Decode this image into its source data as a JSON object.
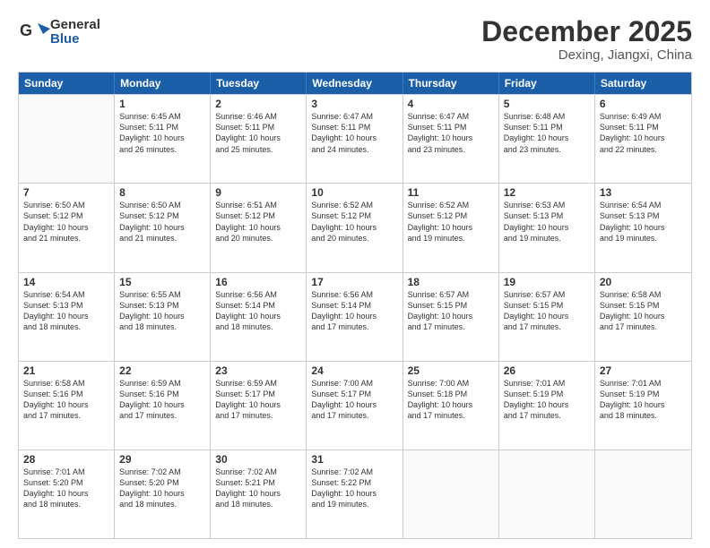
{
  "header": {
    "logo": {
      "line1": "General",
      "line2": "Blue"
    },
    "title": "December 2025",
    "subtitle": "Dexing, Jiangxi, China"
  },
  "calendar": {
    "weekdays": [
      "Sunday",
      "Monday",
      "Tuesday",
      "Wednesday",
      "Thursday",
      "Friday",
      "Saturday"
    ],
    "rows": [
      [
        {
          "day": "",
          "info": ""
        },
        {
          "day": "1",
          "info": "Sunrise: 6:45 AM\nSunset: 5:11 PM\nDaylight: 10 hours\nand 26 minutes."
        },
        {
          "day": "2",
          "info": "Sunrise: 6:46 AM\nSunset: 5:11 PM\nDaylight: 10 hours\nand 25 minutes."
        },
        {
          "day": "3",
          "info": "Sunrise: 6:47 AM\nSunset: 5:11 PM\nDaylight: 10 hours\nand 24 minutes."
        },
        {
          "day": "4",
          "info": "Sunrise: 6:47 AM\nSunset: 5:11 PM\nDaylight: 10 hours\nand 23 minutes."
        },
        {
          "day": "5",
          "info": "Sunrise: 6:48 AM\nSunset: 5:11 PM\nDaylight: 10 hours\nand 23 minutes."
        },
        {
          "day": "6",
          "info": "Sunrise: 6:49 AM\nSunset: 5:11 PM\nDaylight: 10 hours\nand 22 minutes."
        }
      ],
      [
        {
          "day": "7",
          "info": "Sunrise: 6:50 AM\nSunset: 5:12 PM\nDaylight: 10 hours\nand 21 minutes."
        },
        {
          "day": "8",
          "info": "Sunrise: 6:50 AM\nSunset: 5:12 PM\nDaylight: 10 hours\nand 21 minutes."
        },
        {
          "day": "9",
          "info": "Sunrise: 6:51 AM\nSunset: 5:12 PM\nDaylight: 10 hours\nand 20 minutes."
        },
        {
          "day": "10",
          "info": "Sunrise: 6:52 AM\nSunset: 5:12 PM\nDaylight: 10 hours\nand 20 minutes."
        },
        {
          "day": "11",
          "info": "Sunrise: 6:52 AM\nSunset: 5:12 PM\nDaylight: 10 hours\nand 19 minutes."
        },
        {
          "day": "12",
          "info": "Sunrise: 6:53 AM\nSunset: 5:13 PM\nDaylight: 10 hours\nand 19 minutes."
        },
        {
          "day": "13",
          "info": "Sunrise: 6:54 AM\nSunset: 5:13 PM\nDaylight: 10 hours\nand 19 minutes."
        }
      ],
      [
        {
          "day": "14",
          "info": "Sunrise: 6:54 AM\nSunset: 5:13 PM\nDaylight: 10 hours\nand 18 minutes."
        },
        {
          "day": "15",
          "info": "Sunrise: 6:55 AM\nSunset: 5:13 PM\nDaylight: 10 hours\nand 18 minutes."
        },
        {
          "day": "16",
          "info": "Sunrise: 6:56 AM\nSunset: 5:14 PM\nDaylight: 10 hours\nand 18 minutes."
        },
        {
          "day": "17",
          "info": "Sunrise: 6:56 AM\nSunset: 5:14 PM\nDaylight: 10 hours\nand 17 minutes."
        },
        {
          "day": "18",
          "info": "Sunrise: 6:57 AM\nSunset: 5:15 PM\nDaylight: 10 hours\nand 17 minutes."
        },
        {
          "day": "19",
          "info": "Sunrise: 6:57 AM\nSunset: 5:15 PM\nDaylight: 10 hours\nand 17 minutes."
        },
        {
          "day": "20",
          "info": "Sunrise: 6:58 AM\nSunset: 5:15 PM\nDaylight: 10 hours\nand 17 minutes."
        }
      ],
      [
        {
          "day": "21",
          "info": "Sunrise: 6:58 AM\nSunset: 5:16 PM\nDaylight: 10 hours\nand 17 minutes."
        },
        {
          "day": "22",
          "info": "Sunrise: 6:59 AM\nSunset: 5:16 PM\nDaylight: 10 hours\nand 17 minutes."
        },
        {
          "day": "23",
          "info": "Sunrise: 6:59 AM\nSunset: 5:17 PM\nDaylight: 10 hours\nand 17 minutes."
        },
        {
          "day": "24",
          "info": "Sunrise: 7:00 AM\nSunset: 5:17 PM\nDaylight: 10 hours\nand 17 minutes."
        },
        {
          "day": "25",
          "info": "Sunrise: 7:00 AM\nSunset: 5:18 PM\nDaylight: 10 hours\nand 17 minutes."
        },
        {
          "day": "26",
          "info": "Sunrise: 7:01 AM\nSunset: 5:19 PM\nDaylight: 10 hours\nand 17 minutes."
        },
        {
          "day": "27",
          "info": "Sunrise: 7:01 AM\nSunset: 5:19 PM\nDaylight: 10 hours\nand 18 minutes."
        }
      ],
      [
        {
          "day": "28",
          "info": "Sunrise: 7:01 AM\nSunset: 5:20 PM\nDaylight: 10 hours\nand 18 minutes."
        },
        {
          "day": "29",
          "info": "Sunrise: 7:02 AM\nSunset: 5:20 PM\nDaylight: 10 hours\nand 18 minutes."
        },
        {
          "day": "30",
          "info": "Sunrise: 7:02 AM\nSunset: 5:21 PM\nDaylight: 10 hours\nand 18 minutes."
        },
        {
          "day": "31",
          "info": "Sunrise: 7:02 AM\nSunset: 5:22 PM\nDaylight: 10 hours\nand 19 minutes."
        },
        {
          "day": "",
          "info": ""
        },
        {
          "day": "",
          "info": ""
        },
        {
          "day": "",
          "info": ""
        }
      ]
    ]
  }
}
